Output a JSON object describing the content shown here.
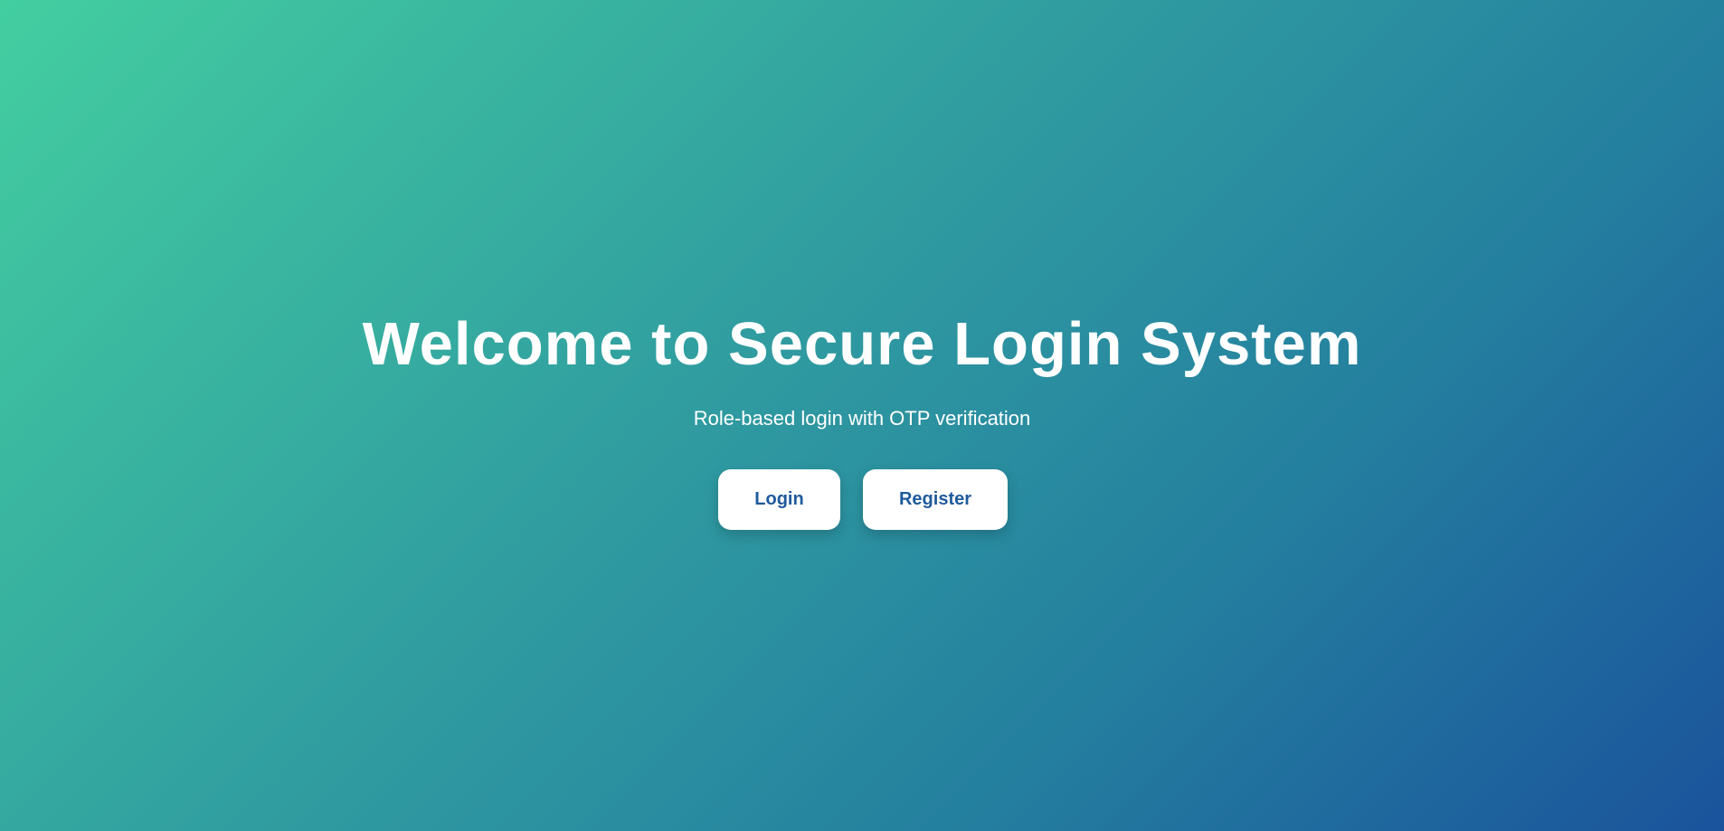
{
  "hero": {
    "title": "Welcome to Secure Login System",
    "subtitle": "Role-based login with OTP verification"
  },
  "actions": {
    "login_label": "Login",
    "register_label": "Register"
  },
  "colors": {
    "gradient_start": "#43cea0",
    "gradient_end": "#1a539c",
    "button_background": "#ffffff",
    "button_text": "#1f5a9c"
  }
}
